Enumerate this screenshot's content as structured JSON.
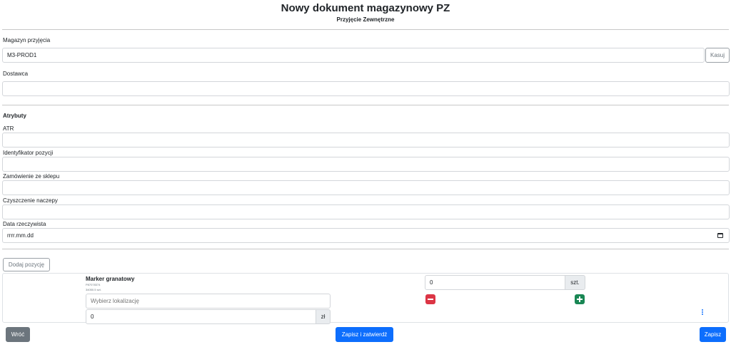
{
  "header": {
    "title": "Nowy dokument magazynowy PZ",
    "subtitle": "Przyjęcie Zewnętrzne"
  },
  "warehouse": {
    "label": "Magazyn przyjęcia",
    "value": "M3-PROD1",
    "clear_label": "Kasuj"
  },
  "supplier": {
    "label": "Dostawca",
    "value": ""
  },
  "attributes": {
    "title": "Atrybuty",
    "fields": [
      {
        "label": "ATR",
        "value": ""
      },
      {
        "label": "Identyfikator pozycji",
        "value": ""
      },
      {
        "label": "Zamówienie ze sklepu",
        "value": ""
      },
      {
        "label": "Czyszczenie naczepy",
        "value": ""
      }
    ],
    "date": {
      "label": "Data rzeczywista",
      "placeholder": "rrrr.mm.dd"
    }
  },
  "add_position_label": "Dodaj pozycję",
  "item": {
    "name": "Marker granatowy",
    "code": "P87078374",
    "stock": "34050.5 szt.",
    "location_placeholder": "Wybierz lokalizację",
    "quantity": "0",
    "quantity_unit": "szt.",
    "price": "0",
    "price_unit": "zł"
  },
  "footer": {
    "back_label": "Wróć",
    "save_confirm_label": "Zapisz i zatwierdź",
    "save_label": "Zapisz"
  },
  "colors": {
    "primary": "#0d6efd",
    "secondary": "#6c757d",
    "danger": "#dc3545",
    "success": "#198754"
  }
}
